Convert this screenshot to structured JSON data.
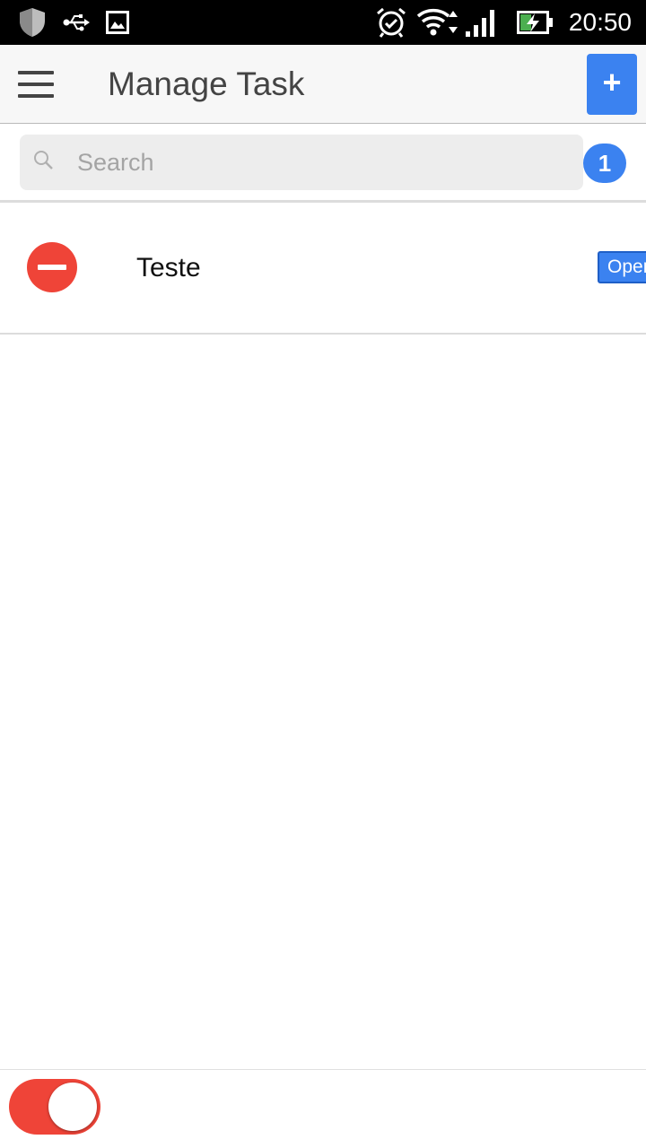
{
  "status_bar": {
    "time": "20:50",
    "icons": [
      "shield-icon",
      "usb-icon",
      "image-icon",
      "alarm-icon",
      "wifi-icon",
      "signal-icon",
      "battery-charging-icon"
    ]
  },
  "header": {
    "title": "Manage Task",
    "add_label": "+",
    "menu_icon": "hamburger-menu-icon"
  },
  "search": {
    "placeholder": "Search",
    "value": "",
    "count": "1"
  },
  "tasks": [
    {
      "name": "Teste",
      "status": "Open"
    }
  ],
  "footer": {
    "toggle_on": true
  },
  "colors": {
    "accent": "#3b82f0",
    "danger": "#ef4438",
    "status_bar": "#000000",
    "header_bg": "#f7f7f7"
  }
}
